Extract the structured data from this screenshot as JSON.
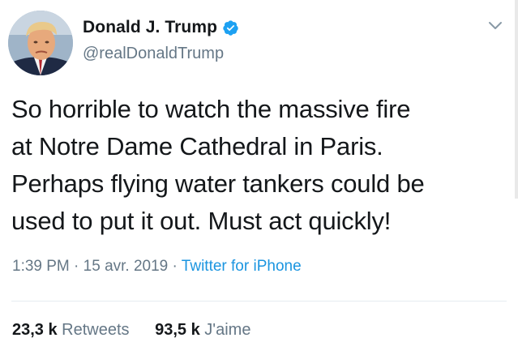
{
  "author": {
    "display_name": "Donald J. Trump",
    "handle": "@realDonaldTrump",
    "verified": true
  },
  "tweet": {
    "text_lines": [
      "So horrible to watch the massive fire",
      "at Notre Dame Cathedral in Paris.",
      "Perhaps flying water tankers could be",
      "used to put it out. Must act quickly!"
    ]
  },
  "meta": {
    "time": "1:39 PM",
    "separator": " · ",
    "date": "15 avr. 2019",
    "source": "Twitter for iPhone"
  },
  "stats": {
    "retweets_count": "23,3 k",
    "retweets_label": "Retweets",
    "likes_count": "93,5 k",
    "likes_label": "J'aime"
  },
  "icons": {
    "verified_badge": "verified-badge-icon",
    "more_options": "chevron-down-icon"
  },
  "colors": {
    "text": "#14171a",
    "secondary": "#657786",
    "link": "#1b95e0",
    "verified": "#1da1f2",
    "divider": "#e6ecf0"
  }
}
